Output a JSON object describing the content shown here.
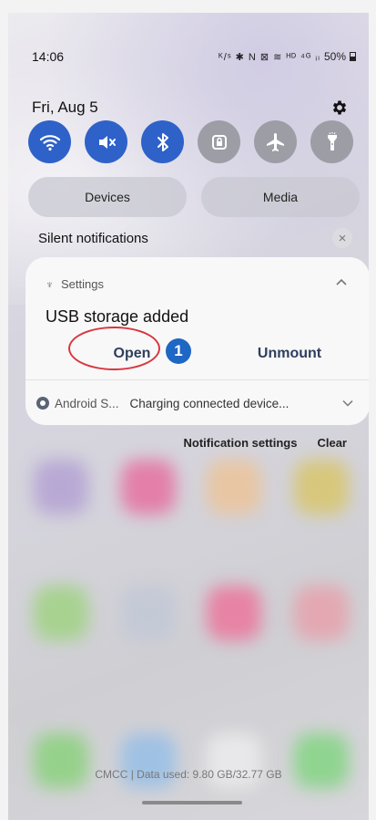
{
  "status_bar": {
    "time": "14:06",
    "icons_text": "ᴷ/ˢ ✱ N ⊠ ≋ ᴴᴰ ⁴ᴳ ᵢₗ",
    "battery": "50%",
    "icon_names": [
      "network-speed-icon",
      "bluetooth-icon",
      "nfc-icon",
      "mute-icon",
      "wifi-calling-icon",
      "hd-icon",
      "signal-icon",
      "battery-icon"
    ]
  },
  "header": {
    "date": "Fri, Aug 5",
    "settings_icon": "gear-icon"
  },
  "quick_toggles": [
    {
      "name": "wifi",
      "icon": "wifi-icon",
      "on": true
    },
    {
      "name": "sound",
      "icon": "mute-icon",
      "on": true
    },
    {
      "name": "bluetooth",
      "icon": "bluetooth-icon",
      "on": true
    },
    {
      "name": "screen-lock",
      "icon": "lock-icon",
      "on": false
    },
    {
      "name": "airplane-mode",
      "icon": "airplane-icon",
      "on": false
    },
    {
      "name": "flashlight",
      "icon": "flashlight-icon",
      "on": false
    }
  ],
  "pills": {
    "devices": "Devices",
    "media": "Media"
  },
  "silent_notifications": {
    "label": "Silent notifications"
  },
  "notification": {
    "app": "Settings",
    "title": "USB storage added",
    "actions": {
      "open": "Open",
      "unmount": "Unmount"
    },
    "step_badge": "1",
    "sub": {
      "app": "Android S...",
      "text": "Charging connected device..."
    }
  },
  "footer": {
    "notification_settings": "Notification settings",
    "clear": "Clear"
  },
  "home": {
    "data_used": "CMCC | Data used: 9.80 GB/32.77 GB"
  },
  "colors": {
    "toggle_on": "#2e62c9",
    "toggle_off": "#9d9da6",
    "highlight": "#d9363e",
    "badge": "#1f67c4"
  }
}
